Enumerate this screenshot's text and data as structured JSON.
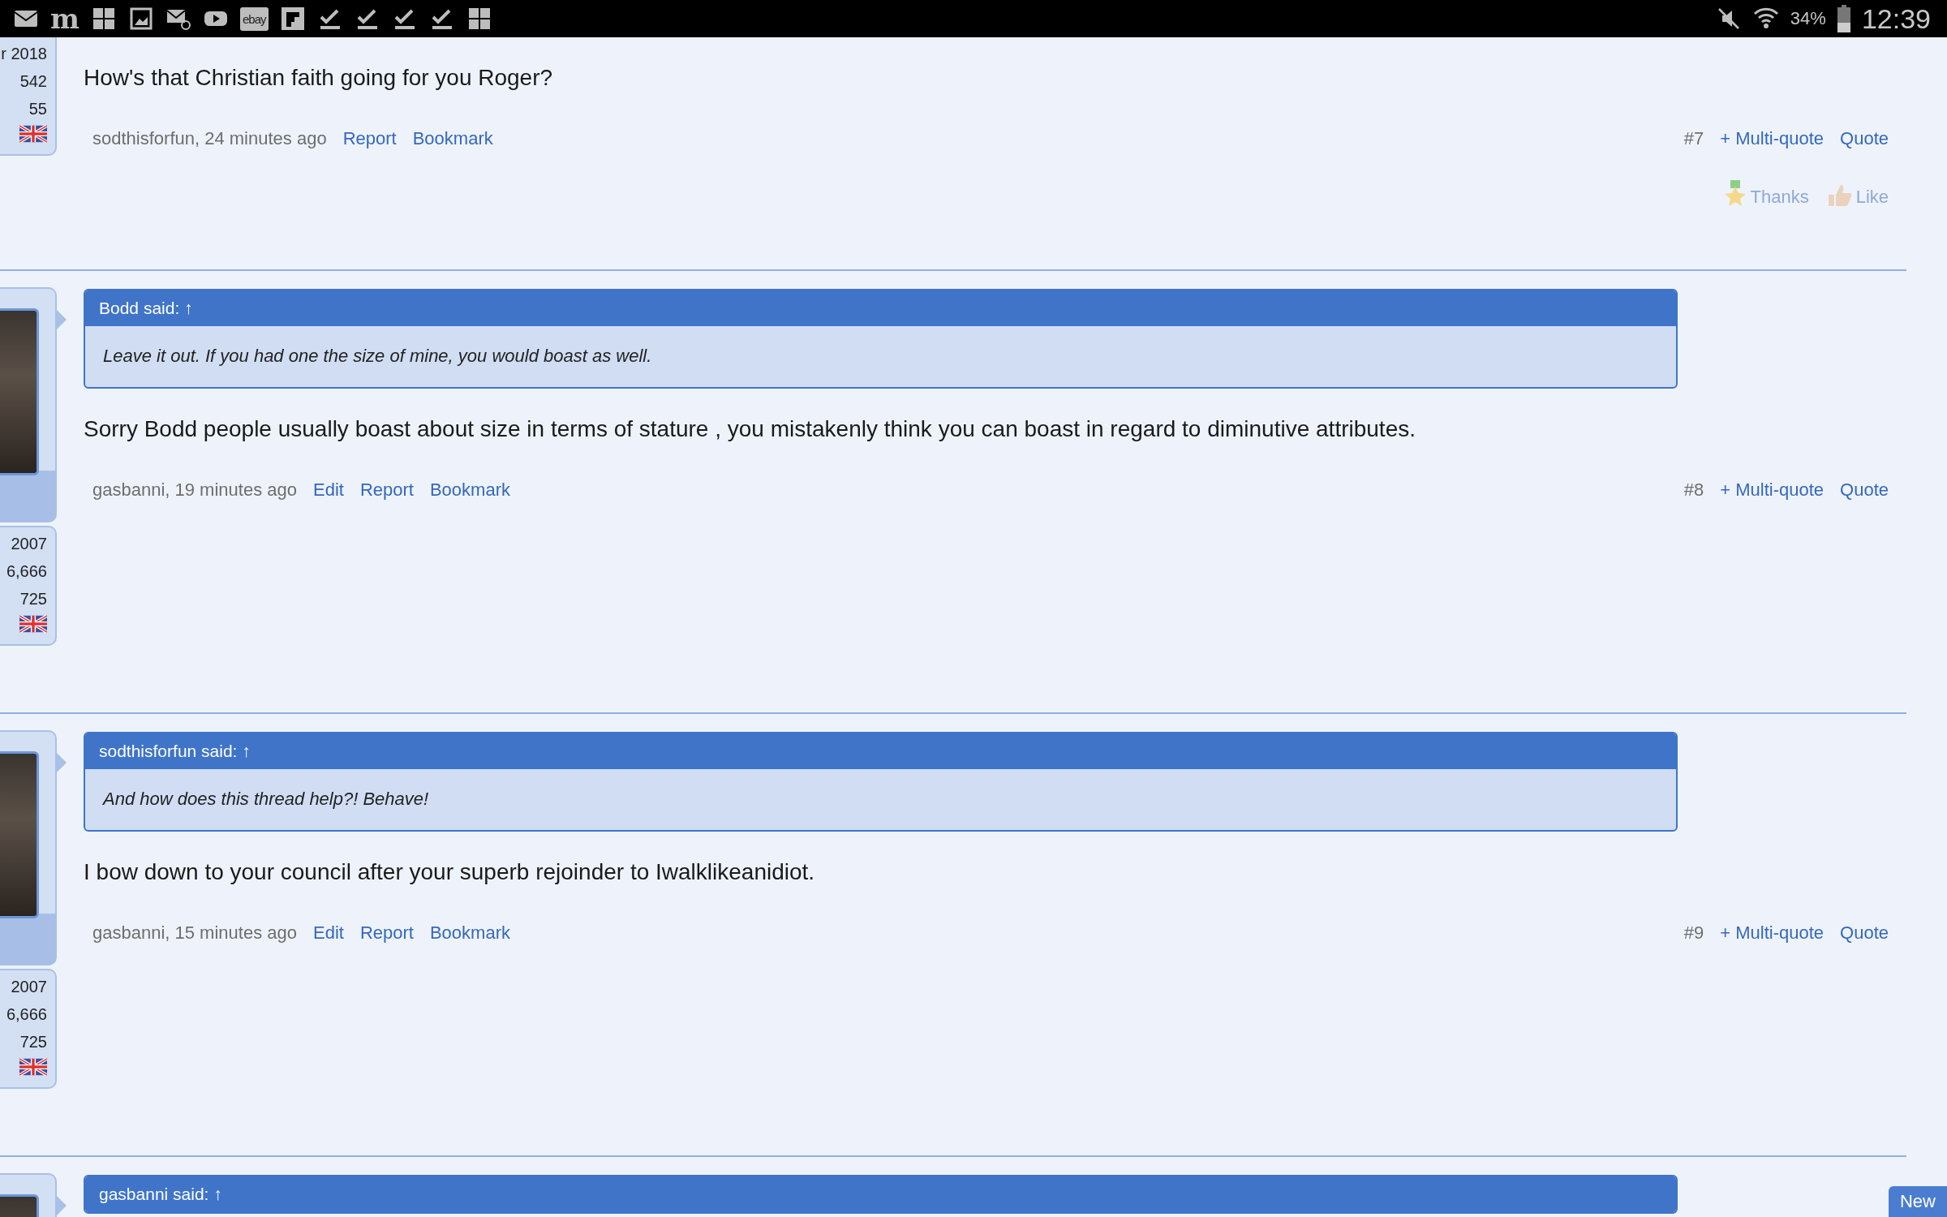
{
  "status_bar": {
    "left_icons": [
      {
        "kind": "mail"
      },
      {
        "kind": "letter",
        "label": "m"
      },
      {
        "kind": "glitch"
      },
      {
        "kind": "image"
      },
      {
        "kind": "mail-at"
      },
      {
        "kind": "play"
      },
      {
        "kind": "tile",
        "label": "ebay"
      },
      {
        "kind": "flip"
      },
      {
        "kind": "check"
      },
      {
        "kind": "check"
      },
      {
        "kind": "check"
      },
      {
        "kind": "check"
      },
      {
        "kind": "glitch"
      }
    ],
    "battery_text": "34%",
    "time": "12:39"
  },
  "posts": [
    {
      "kind": "cut_top",
      "stats": [
        "r 2018",
        "542",
        "55"
      ],
      "message": "How's that Christian faith going for you Roger?",
      "author": "sodthisforfun, 24 minutes ago",
      "links": [
        "Report",
        "Bookmark"
      ],
      "number": "#7",
      "right_links": [
        "+ Multi-quote",
        "Quote"
      ],
      "reactions": [
        {
          "kind": "thanks",
          "label": "Thanks"
        },
        {
          "kind": "like",
          "label": "Like"
        }
      ]
    },
    {
      "kind": "full",
      "stats": [
        "2007",
        "6,666",
        "725"
      ],
      "quote": {
        "header": "Bodd said: ↑",
        "text": "Leave it out. If you had one the size of mine, you would boast as well."
      },
      "message": "Sorry Bodd people usually boast about size in terms of stature , you mistakenly think you can boast in regard to diminutive attributes.",
      "author": "gasbanni, 19 minutes ago",
      "links": [
        "Edit",
        "Report",
        "Bookmark"
      ],
      "number": "#8",
      "right_links": [
        "+ Multi-quote",
        "Quote"
      ]
    },
    {
      "kind": "full",
      "stats": [
        "2007",
        "6,666",
        "725"
      ],
      "quote": {
        "header": "sodthisforfun said: ↑",
        "text": "And how does this thread help?! Behave!"
      },
      "message": "I bow down to your council after your superb rejoinder to Iwalklikeanidiot.",
      "author": "gasbanni, 15 minutes ago",
      "links": [
        "Edit",
        "Report",
        "Bookmark"
      ],
      "number": "#9",
      "right_links": [
        "+ Multi-quote",
        "Quote"
      ]
    },
    {
      "kind": "cut_bottom",
      "quote": {
        "header": "gasbanni said: ↑"
      }
    }
  ],
  "new_button": "New"
}
